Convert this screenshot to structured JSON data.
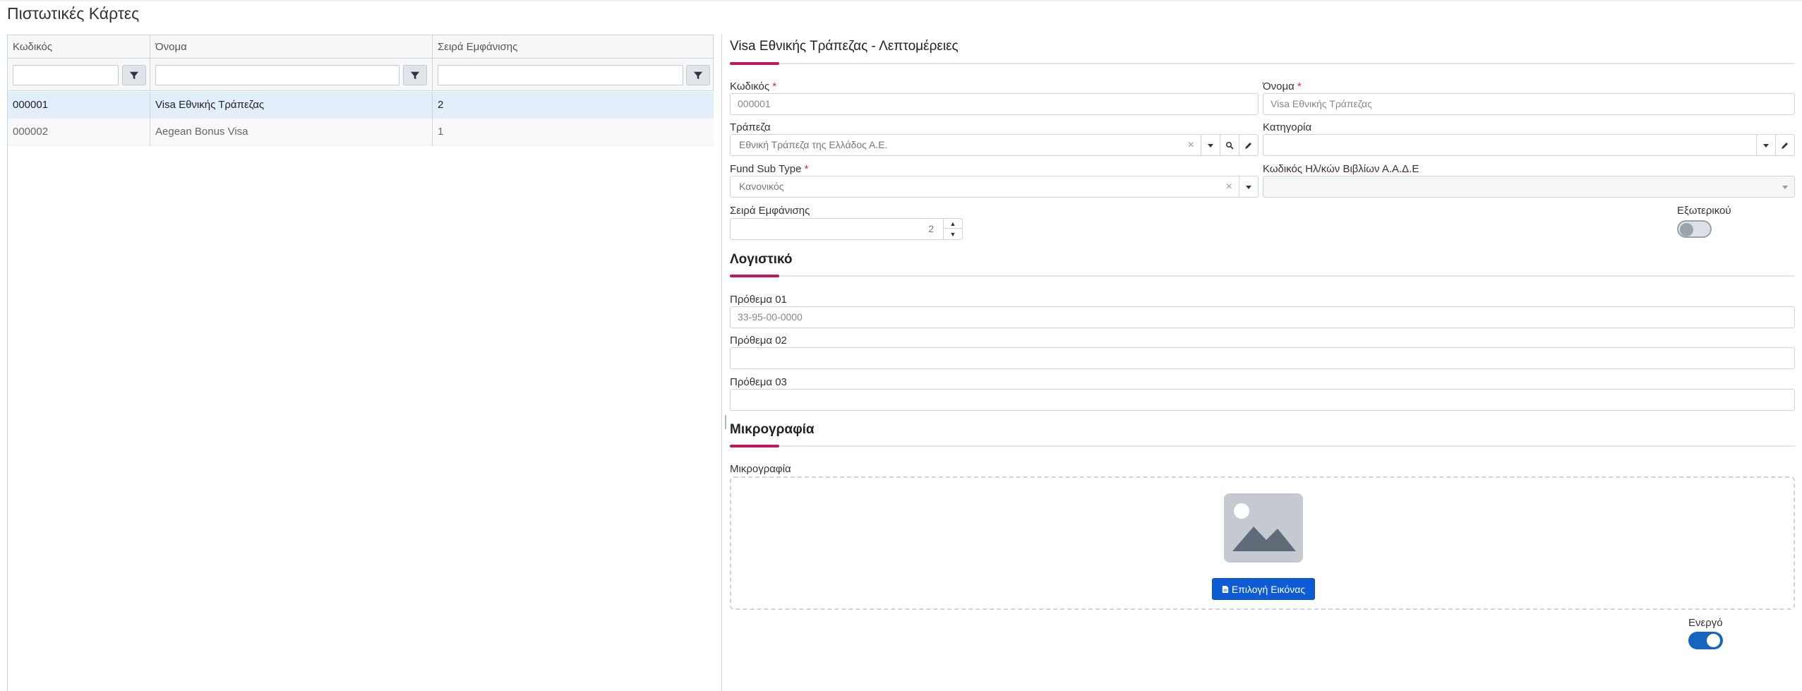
{
  "page": {
    "title": "Πιστωτικές Κάρτες"
  },
  "grid": {
    "columns": [
      {
        "label": "Κωδικός"
      },
      {
        "label": "Όνομα"
      },
      {
        "label": "Σειρά Εμφάνισης"
      }
    ],
    "rows": [
      {
        "code": "000001",
        "name": "Visa Εθνικής Τράπεζας",
        "order": "2",
        "selected": true
      },
      {
        "code": "000002",
        "name": "Aegean Bonus Visa",
        "order": "1",
        "selected": false
      }
    ]
  },
  "details": {
    "title": "Visa Εθνικής Τράπεζας - Λεπτομέρειες",
    "code": {
      "label": "Κωδικός",
      "required": "*",
      "value": "000001"
    },
    "name": {
      "label": "Όνομα",
      "required": "*",
      "value": "Visa Εθνικής Τράπεζας"
    },
    "bank": {
      "label": "Τράπεζα",
      "value": "Εθνική Τράπεζα της Ελλάδος Α.Ε."
    },
    "category": {
      "label": "Κατηγορία",
      "value": ""
    },
    "fund_sub_type": {
      "label": "Fund Sub Type",
      "required": "*",
      "value": "Κανονικός"
    },
    "aade_code": {
      "label": "Κωδικός Ηλ/κών Βιβλίων Α.Α.Δ.Ε",
      "value": ""
    },
    "display_order": {
      "label": "Σειρά Εμφάνισης",
      "value": "2"
    },
    "foreign": {
      "label": "Εξωτερικού",
      "on": false
    }
  },
  "accounting": {
    "title": "Λογιστικό",
    "prefix1": {
      "label": "Πρόθεμα 01",
      "value": "33-95-00-0000"
    },
    "prefix2": {
      "label": "Πρόθεμα 02",
      "value": ""
    },
    "prefix3": {
      "label": "Πρόθεμα 03",
      "value": ""
    }
  },
  "thumbnail": {
    "title": "Μικρογραφία",
    "label": "Μικρογραφία",
    "button": "Επιλογή Εικόνας"
  },
  "active": {
    "label": "Ενεργό",
    "on": true
  },
  "colors": {
    "accent": "#c2185b",
    "primary": "#0d5cd6",
    "selected_row": "#e3eefb"
  }
}
